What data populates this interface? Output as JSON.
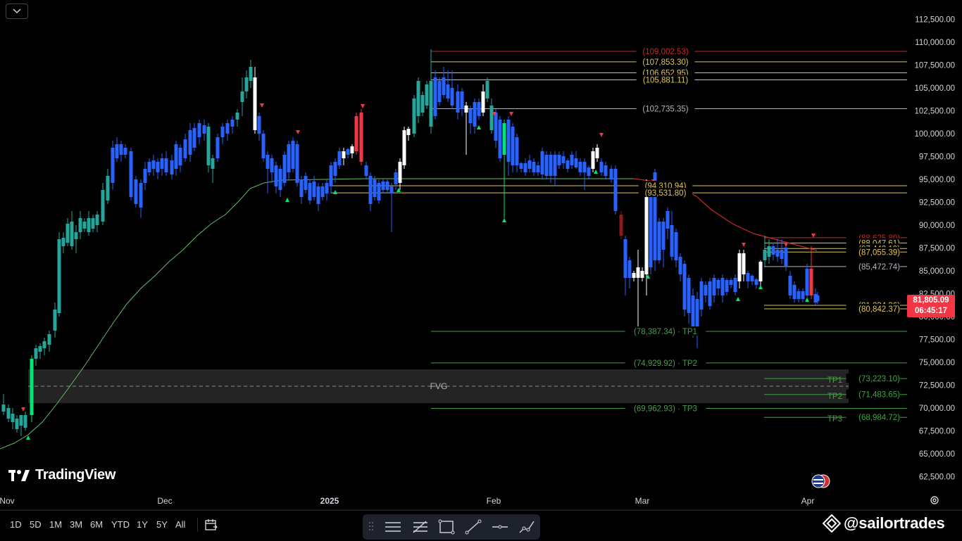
{
  "price_axis": {
    "ticks": [
      "112,500.00",
      "110,000.00",
      "107,500.00",
      "105,000.00",
      "102,500.00",
      "100,000.00",
      "97,500.00",
      "95,000.00",
      "92,500.00",
      "90,000.00",
      "87,500.00",
      "85,000.00",
      "82,500.00",
      "80,000.00",
      "77,500.00",
      "75,000.00",
      "72,500.00",
      "70,000.00",
      "67,500.00",
      "65,000.00",
      "62,500.00"
    ]
  },
  "time_axis": {
    "labels": [
      "Nov",
      "Dec",
      "2025",
      "Feb",
      "Mar",
      "Apr"
    ]
  },
  "current_price": {
    "value": "81,805.09",
    "countdown": "06:45:17",
    "color": "#f23645"
  },
  "levels": [
    {
      "label": "(109,002.53)",
      "color": "#c62828"
    },
    {
      "label": "(107,853.30)",
      "color": "#e0c45c"
    },
    {
      "label": "(106,652.95)",
      "color": "#e0c45c"
    },
    {
      "label": "(105,881.11)",
      "color": "#e0c45c"
    },
    {
      "label": "(102,735.35)",
      "color": "#b2b5be"
    },
    {
      "label": "(94,310.94)",
      "color": "#e0c45c"
    },
    {
      "label": "(93,531.80)",
      "color": "#e0c45c"
    },
    {
      "label": "(78,387.34) · TP1",
      "color": "#43a047"
    },
    {
      "label": "(74,929.92) · TP2",
      "color": "#43a047"
    },
    {
      "label": "(69,962.93) · TP3",
      "color": "#43a047"
    },
    {
      "label": "(88,625.80)",
      "color": "#c62828"
    },
    {
      "label": "(88,047.61)",
      "color": "#e0c45c"
    },
    {
      "label": "(87,442.19)",
      "color": "#e0c45c"
    },
    {
      "label": "(87,055.39)",
      "color": "#e0c45c"
    },
    {
      "label": "(85,472.74)",
      "color": "#b2b5be"
    },
    {
      "label": "(81,234.36)",
      "color": "#e0c45c"
    },
    {
      "label": "(80,842.37)",
      "color": "#e0c45c"
    },
    {
      "label": "(73,223.10)",
      "color": "#43a047"
    },
    {
      "label": "(71,483.65)",
      "color": "#43a047"
    },
    {
      "label": "(68,984.72)",
      "color": "#43a047"
    }
  ],
  "tp_tags": [
    "TP1",
    "TP2",
    "TP3"
  ],
  "fvg_label": "FVG",
  "brand": {
    "name": "TradingView"
  },
  "range_buttons": [
    "1D",
    "5D",
    "1M",
    "3M",
    "6M",
    "YTD",
    "1Y",
    "5Y",
    "All"
  ],
  "drawing_tools": [
    "horizontal-lines-icon",
    "fib-icon",
    "rectangle-icon",
    "trendline-icon",
    "horizontal-line-icon",
    "path-icon"
  ],
  "watermark": {
    "text": "@sailortrades"
  },
  "colors": {
    "up": "#ffffff",
    "down": "#2962ff",
    "accent_green": "#26a69a",
    "bright_green": "#00e676",
    "red": "#f23645",
    "ma": "#4caf50",
    "ma_red": "#c62828"
  }
}
